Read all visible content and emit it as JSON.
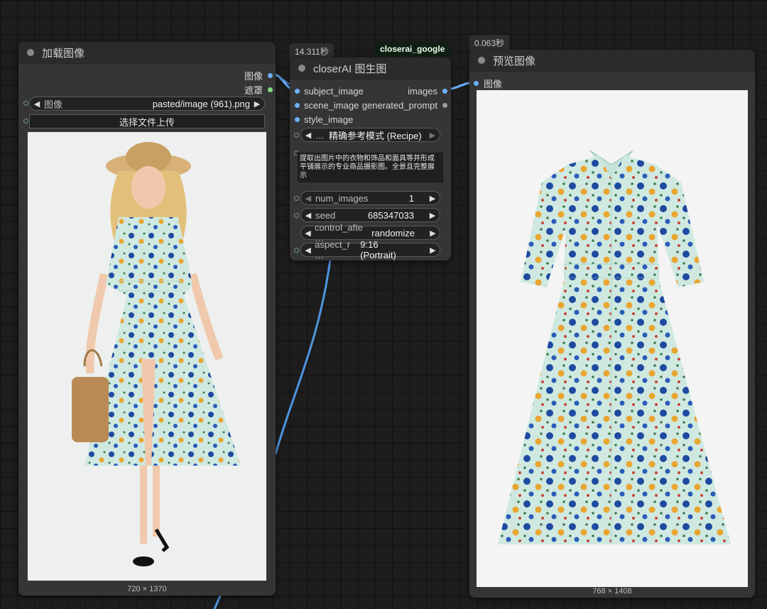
{
  "load_node": {
    "title": "加载图像",
    "output_image": "图像",
    "output_mask": "遮罩",
    "image_label": "图像",
    "image_value": "pasted/image (961).png",
    "upload_label": "选择文件上传",
    "dimensions": "720 × 1370"
  },
  "closer_node": {
    "time_badge": "14.311秒",
    "tag_badge": "closerai_google",
    "title": "closerAI 图生图",
    "inputs": [
      "subject_image",
      "scene_image",
      "style_image"
    ],
    "outputs": [
      "images",
      "generated_prompt"
    ],
    "mode_value": "精确参考模式 (Recipe)",
    "mode_prefix": "…",
    "prompt_text": "提取出图片中的衣物和饰品和面具等并形成平铺展示的专业商品摄影图。全景且完整展示",
    "widgets": [
      {
        "label": "num_images",
        "value": "1"
      },
      {
        "label": "seed",
        "value": "685347033"
      },
      {
        "label": "control_afte …",
        "value": "randomize"
      },
      {
        "label": "aspect_r …",
        "value": "9:16 (Portrait)"
      }
    ]
  },
  "preview_node": {
    "time_badge": "0.063秒",
    "title": "预览图像",
    "input_image": "图像",
    "dimensions": "768 × 1408"
  },
  "colors": {
    "canvas": "#1d1d1d",
    "node": "#353535",
    "image_wire": "#6cb2ff",
    "mask_wire": "#7ddc7d"
  }
}
